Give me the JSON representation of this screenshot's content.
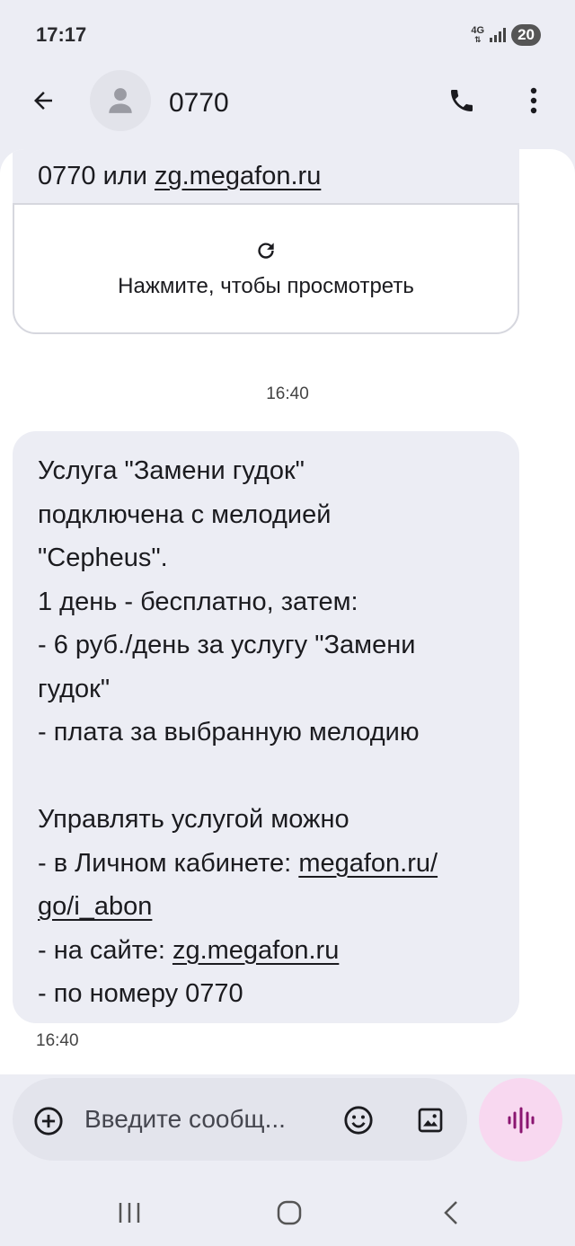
{
  "status": {
    "time": "17:17",
    "network": "4G",
    "battery": "20"
  },
  "header": {
    "contact": "0770"
  },
  "messages": {
    "first": {
      "text_prefix": "0770 или ",
      "link": "zg.megafon.ru",
      "preview_label": "Нажмите, чтобы просмотреть"
    },
    "timestamp_center": "16:40",
    "second": {
      "lines": [
        "Услуга \"Замени гудок\"",
        "подключена с мелодией",
        "\"Cepheus\".",
        "1 день - бесплатно, затем:",
        "- 6 руб./день за услугу \"Замени",
        "гудок\"",
        "- плата за выбранную мелодию",
        "",
        "Управлять услугой можно",
        "- в Личном кабинете: ",
        "go/i_abon",
        "- на сайте: ",
        "- по номеру 0770"
      ],
      "link_cabinet_1": "megafon.ru/",
      "link_site": "zg.megafon.ru"
    },
    "timestamp_left": "16:40"
  },
  "composer": {
    "placeholder": "Введите сообщ..."
  }
}
